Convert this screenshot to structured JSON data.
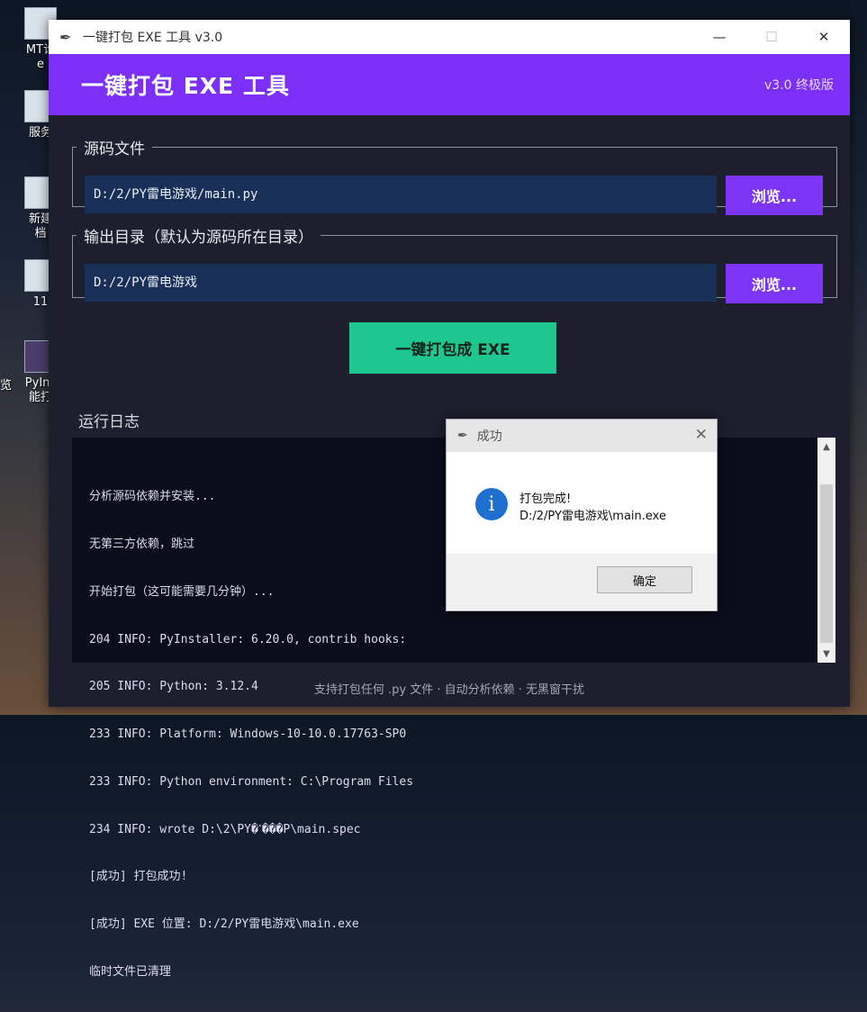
{
  "desktop": {
    "icons": [
      {
        "label_line1": "MT论",
        "label_line2": "e"
      },
      {
        "label_line1": "服务",
        "label_line2": ""
      },
      {
        "label_line1": "新建",
        "label_line2": "档"
      },
      {
        "label_line1": "11",
        "label_line2": ""
      },
      {
        "label_line1": "PyIns",
        "label_line2": "能打"
      }
    ],
    "edge_text": "览"
  },
  "window": {
    "title": "一键打包 EXE 工具 v3.0",
    "controls": {
      "minimize": "—",
      "maximize": "☐",
      "close": "✕"
    }
  },
  "banner": {
    "heading": "一键打包 EXE 工具",
    "version": "v3.0 终极版"
  },
  "source": {
    "legend": "源码文件",
    "path": "D:/2/PY雷电游戏/main.py",
    "browse_label": "浏览..."
  },
  "output": {
    "legend": "输出目录（默认为源码所在目录）",
    "path": "D:/2/PY雷电游戏",
    "browse_label": "浏览..."
  },
  "pack_button": "一键打包成 EXE",
  "log": {
    "title": "运行日志",
    "lines": [
      "分析源码依赖并安装...",
      "无第三方依赖，跳过",
      "开始打包（这可能需要几分钟）...",
      "204 INFO: PyInstaller: 6.20.0, contrib hooks: ",
      "205 INFO: Python: 3.12.4",
      "233 INFO: Platform: Windows-10-10.0.17763-SP0",
      "233 INFO: Python environment: C:\\Program Files",
      "234 INFO: wrote D:\\2\\PY�ߵ���P\\main.spec",
      "[成功] 打包成功!",
      "[成功] EXE 位置: D:/2/PY雷电游戏\\main.exe",
      "临时文件已清理"
    ]
  },
  "footer": "支持打包任何 .py 文件 · 自动分析依赖 · 无黑窗干扰",
  "dialog": {
    "title": "成功",
    "close": "✕",
    "icon": "info-icon",
    "message_line1": "打包完成!",
    "message_line2": "D:/2/PY雷电游戏\\main.exe",
    "ok_label": "确定"
  },
  "colors": {
    "banner": "#7b2ff7",
    "browse": "#7c35f5",
    "pack": "#1ec790",
    "path_field": "#183058",
    "window_bg": "#1d1f2e",
    "log_bg": "#0c0c1c"
  }
}
